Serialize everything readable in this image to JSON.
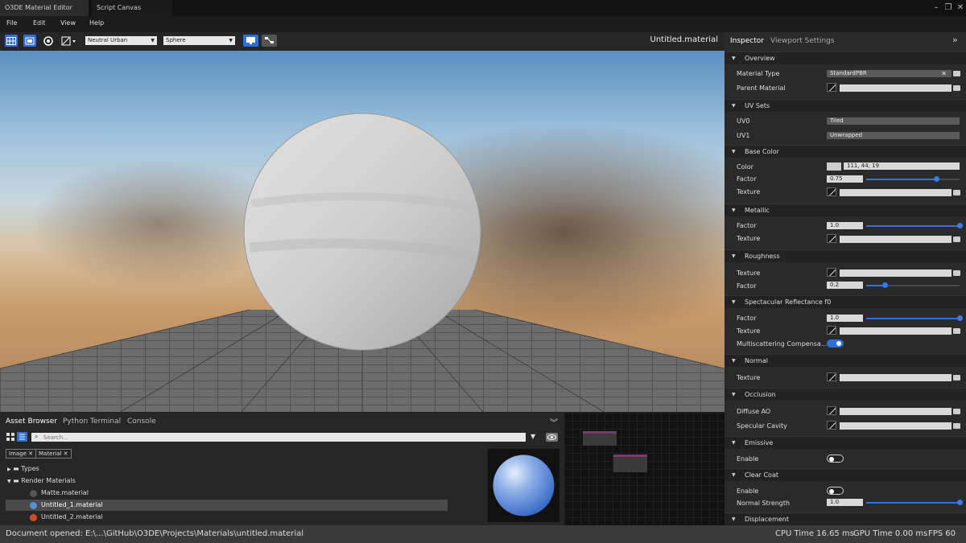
{
  "window": {
    "tabs": [
      "O3DE Material Editor",
      "Script Canvas"
    ]
  },
  "menu": [
    "File",
    "Edit",
    "View",
    "Help"
  ],
  "toolbar": {
    "lighting_preset": "Neutral Urban",
    "model_preset": "Sphere",
    "document_title": "Untitled.material"
  },
  "asset_browser": {
    "tabs": [
      "Asset Browser",
      "Python Terminal",
      "Console"
    ],
    "search_placeholder": "Search...",
    "filters": [
      "Image",
      "Material"
    ],
    "tree": {
      "types": "Types",
      "render_materials": "Render Materials",
      "files": [
        "Matte.material",
        "Untitled_1.material",
        "Untitled_2.material"
      ]
    },
    "selected_index": 1
  },
  "inspector": {
    "tabs": [
      "Inspector",
      "Viewport Settings"
    ],
    "sections": {
      "overview": "Overview",
      "uv_sets": "UV Sets",
      "base_color": "Base Color",
      "metallic": "Metallic",
      "roughness": "Roughness",
      "specular": "Spectacular Reflectance f0",
      "normal": "Normal",
      "occlusion": "Occlusion",
      "emissive": "Emissive",
      "clear_coat": "Clear Coat",
      "displacement": "Displacement"
    },
    "labels": {
      "material_type": "Material Type",
      "parent_material": "Parent Material",
      "uv0": "UV0",
      "uv1": "UV1",
      "color": "Color",
      "factor": "Factor",
      "texture": "Texture",
      "multiscattering": "Multiscattering Compensa...",
      "diffuse_ao": "Diffuse AO",
      "specular_cavity": "Specular Cavity",
      "enable": "Enable",
      "normal_strength": "Normal Strength"
    },
    "values": {
      "material_type": "StandardPBR",
      "uv0": "Tiled",
      "uv1": "Unwrapped",
      "base_color_rgb": "111, 44, 19",
      "base_color_factor": "0.75",
      "metallic_factor": "1.0",
      "roughness_factor": "0.2",
      "specular_factor": "1.0",
      "normal_strength": "1.0"
    },
    "slider_levels": {
      "base_color_factor": 0.75,
      "metallic_factor": 1.0,
      "roughness_factor": 0.2,
      "specular_factor": 1.0,
      "normal_strength": 1.0
    },
    "toggles": {
      "multiscattering": true,
      "emissive_enable": false,
      "clear_coat_enable": false
    }
  },
  "status": {
    "message": "Document opened: E:\\...\\GitHub\\O3DE\\Projects\\Materials\\untitled.material",
    "cpu_time": "CPU Time 16.65 ms",
    "gpu_time": "GPU Time 0.00 ms",
    "fps": "FPS 60"
  },
  "colors": {
    "accent": "#2f6fd8",
    "background": "#2a2a2a"
  }
}
